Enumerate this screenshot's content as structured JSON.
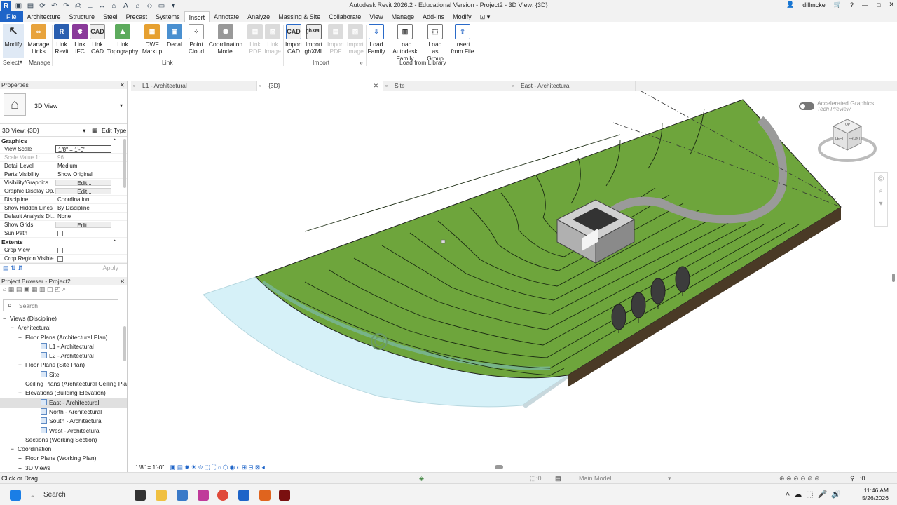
{
  "app": {
    "title": "Autodesk Revit 2026.2 - Educational Version - Project2 - 3D View: {3D}",
    "user": "dillmcke",
    "logo": "R"
  },
  "menu_tabs": [
    "File",
    "Architecture",
    "Structure",
    "Steel",
    "Precast",
    "Systems",
    "Insert",
    "Annotate",
    "Analyze",
    "Massing & Site",
    "Collaborate",
    "View",
    "Manage",
    "Add-Ins",
    "Modify"
  ],
  "active_tab": "Insert",
  "ribbon": {
    "modify": "Modify",
    "manage_links": "Manage Links",
    "link_revit": "Link Revit",
    "link_ifc": "Link IFC",
    "link_cad": "Link CAD",
    "link_topography": "Link Topography",
    "dwf_markup": "DWF Markup",
    "decal": "Decal",
    "point_cloud": "Point Cloud",
    "coordination_model": "Coordination Model",
    "link_pdf": "Link PDF",
    "link_image": "Link Image",
    "import_cad": "Import CAD",
    "import_gbxml": "Import gbXML",
    "import_pdf": "Import PDF",
    "import_image": "Import Image",
    "load_family": "Load Family",
    "load_autodesk_family": "Load Autodesk Family",
    "load_as_group": "Load as Group",
    "insert_from_file": "Insert from File",
    "groups": {
      "select": "Select",
      "manage": "Manage",
      "link": "Link",
      "import": "Import",
      "load_from_library": "Load from Library"
    }
  },
  "properties": {
    "header": "Properties",
    "type_name": "3D View",
    "instance_selector": "3D View: {3D}",
    "edit_type": "Edit Type",
    "sections": {
      "graphics": "Graphics",
      "extents": "Extents"
    },
    "rows": [
      {
        "k": "View Scale",
        "v": "1/8\" = 1'-0\"",
        "kind": "input"
      },
      {
        "k": "Scale Value    1:",
        "v": "96",
        "kind": "muted"
      },
      {
        "k": "Detail Level",
        "v": "Medium",
        "kind": "text"
      },
      {
        "k": "Parts Visibility",
        "v": "Show Original",
        "kind": "text"
      },
      {
        "k": "Visibility/Graphics ...",
        "v": "Edit...",
        "kind": "btn"
      },
      {
        "k": "Graphic Display Op...",
        "v": "Edit...",
        "kind": "btn"
      },
      {
        "k": "Discipline",
        "v": "Coordination",
        "kind": "text"
      },
      {
        "k": "Show Hidden Lines",
        "v": "By Discipline",
        "kind": "text"
      },
      {
        "k": "Default Analysis Di...",
        "v": "None",
        "kind": "text"
      },
      {
        "k": "Show Grids",
        "v": "Edit...",
        "kind": "btn"
      },
      {
        "k": "Sun Path",
        "v": "",
        "kind": "check"
      }
    ],
    "extents_rows": [
      {
        "k": "Crop View",
        "v": "",
        "kind": "check"
      },
      {
        "k": "Crop Region Visible",
        "v": "",
        "kind": "check"
      }
    ],
    "apply": "Apply"
  },
  "browser": {
    "header": "Project Browser - Project2",
    "search_placeholder": "Search",
    "items": [
      {
        "label": "Views (Discipline)",
        "indent": 0,
        "exp": "−",
        "box": false
      },
      {
        "label": "Architectural",
        "indent": 1,
        "exp": "−",
        "box": false
      },
      {
        "label": "Floor Plans (Architectural Plan)",
        "indent": 2,
        "exp": "−",
        "box": false
      },
      {
        "label": "L1 - Architectural",
        "indent": 4,
        "exp": "",
        "box": true
      },
      {
        "label": "L2 - Architectural",
        "indent": 4,
        "exp": "",
        "box": true
      },
      {
        "label": "Floor Plans (Site Plan)",
        "indent": 2,
        "exp": "−",
        "box": false
      },
      {
        "label": "Site",
        "indent": 4,
        "exp": "",
        "box": true
      },
      {
        "label": "Ceiling Plans (Architectural Ceiling Pla",
        "indent": 2,
        "exp": "+",
        "box": false
      },
      {
        "label": "Elevations (Building Elevation)",
        "indent": 2,
        "exp": "−",
        "box": false
      },
      {
        "label": "East - Architectural",
        "indent": 4,
        "exp": "",
        "box": true,
        "selected": true
      },
      {
        "label": "North - Architectural",
        "indent": 4,
        "exp": "",
        "box": true
      },
      {
        "label": "South - Architectural",
        "indent": 4,
        "exp": "",
        "box": true
      },
      {
        "label": "West - Architectural",
        "indent": 4,
        "exp": "",
        "box": true
      },
      {
        "label": "Sections (Working Section)",
        "indent": 2,
        "exp": "+",
        "box": false
      },
      {
        "label": "Coordination",
        "indent": 1,
        "exp": "−",
        "box": false
      },
      {
        "label": "Floor Plans (Working Plan)",
        "indent": 2,
        "exp": "+",
        "box": false
      },
      {
        "label": "3D Views",
        "indent": 2,
        "exp": "+",
        "box": false
      }
    ]
  },
  "view_tabs": [
    {
      "label": "L1 - Architectural",
      "active": false
    },
    {
      "label": "{3D}",
      "active": true
    },
    {
      "label": "Site",
      "active": false
    },
    {
      "label": "East - Architectural",
      "active": false
    }
  ],
  "viewport": {
    "accel_label": "Accelerated Graphics",
    "accel_sub": "Tech Preview",
    "cube_top": "TOP",
    "cube_left": "LEFT",
    "cube_front": "FRONT"
  },
  "view_control_bar": {
    "scale": "1/8\" = 1'-0\""
  },
  "status": {
    "text": "Click or Drag",
    "model": "Main Model",
    "count_left": ":0",
    "count_right": ":0"
  },
  "taskbar": {
    "search": "Search",
    "time": "11:46 AM",
    "date": "5/26/2026"
  },
  "colors": {
    "terrain": "#6ea53c",
    "water": "#d6f1f8",
    "revit_blue": "#1e64c8",
    "soil": "#4a3a26"
  }
}
